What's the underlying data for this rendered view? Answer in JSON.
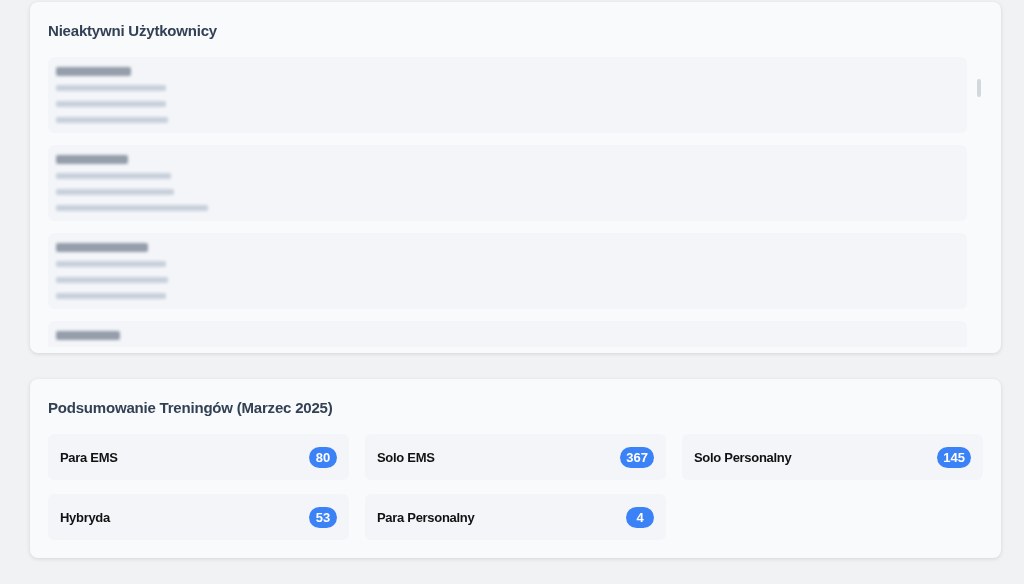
{
  "inactive_users": {
    "title": "Nieaktywni Użytkownicy",
    "users": [
      {
        "kind": "redacted"
      },
      {
        "kind": "redacted"
      },
      {
        "kind": "redacted"
      },
      {
        "kind": "redacted"
      }
    ]
  },
  "training_summary": {
    "title": "Podsumowanie Treningów (Marzec 2025)",
    "items": [
      {
        "label": "Para EMS",
        "count": "80"
      },
      {
        "label": "Solo EMS",
        "count": "367"
      },
      {
        "label": "Solo Personalny",
        "count": "145"
      },
      {
        "label": "Hybryda",
        "count": "53"
      },
      {
        "label": "Para Personalny",
        "count": "4"
      }
    ]
  }
}
